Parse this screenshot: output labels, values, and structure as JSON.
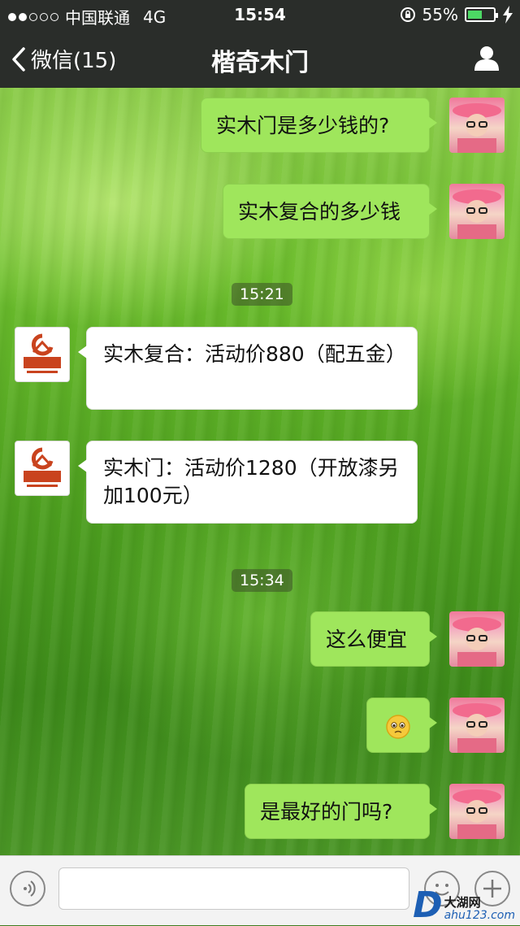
{
  "status": {
    "carrier": "中国联通",
    "network": "4G",
    "time": "15:54",
    "battery": "55%",
    "battery_level": 0.55
  },
  "nav": {
    "back_label": "微信(15)",
    "title": "楷奇木门"
  },
  "messages": {
    "m1": "实木门是多少钱的?",
    "m2": "实木复合的多少钱",
    "t1": "15:21",
    "m3": "实木复合：活动价880（配五金）",
    "m4": "实木门：活动价1280（开放漆另加100元）",
    "t2": "15:34",
    "m5": "这么便宜",
    "m6_emoji": "🥺",
    "m7": "是最好的门吗?"
  },
  "watermark": {
    "brand": "大湖网",
    "url": "ahu123.com"
  },
  "colors": {
    "bar_bg": "#2a2d2a",
    "bubble_out": "#9fe65c",
    "bubble_in": "#ffffff",
    "battery_fill": "#4cd964"
  }
}
